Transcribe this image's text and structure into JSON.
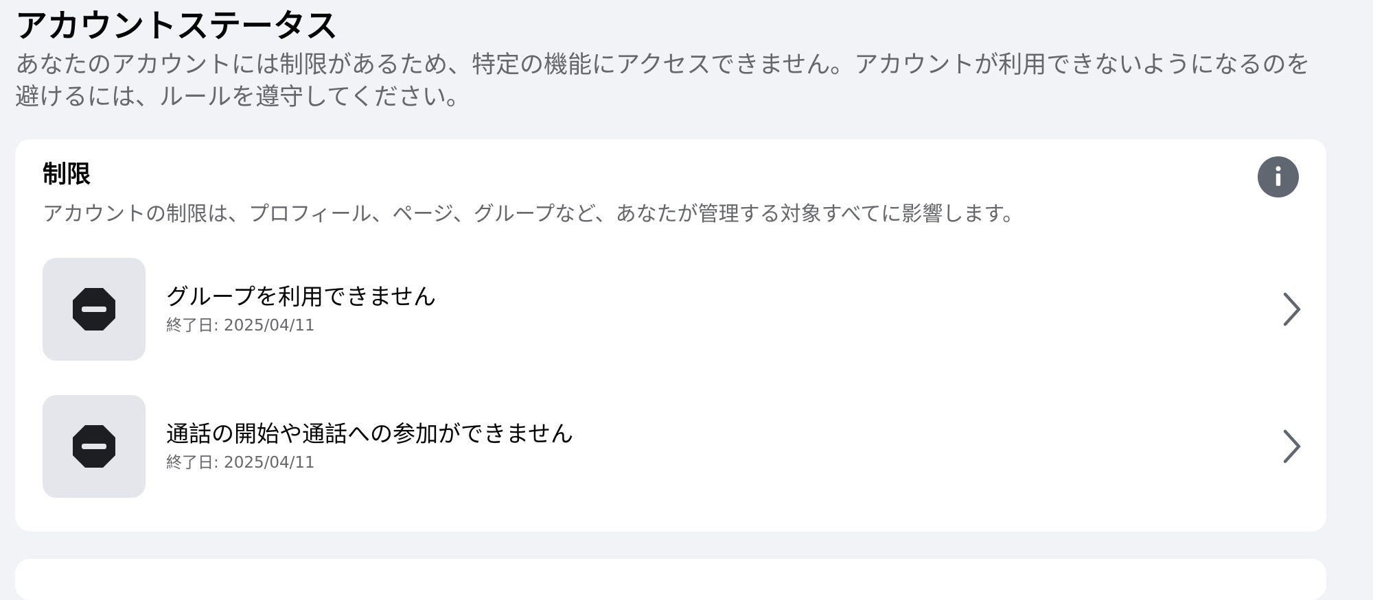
{
  "header": {
    "title": "アカウントステータス",
    "subtitle": "あなたのアカウントには制限があるため、特定の機能にアクセスできません。アカウントが利用できないようになるのを避けるには、ルールを遵守してください。"
  },
  "restrictions_card": {
    "title": "制限",
    "description": "アカウントの制限は、プロフィール、ページ、グループなど、あなたが管理する対象すべてに影響します。",
    "info_icon": "info-icon",
    "items": [
      {
        "icon": "restricted-icon",
        "title": "グループを利用できません",
        "end_date": "終了日: 2025/04/11"
      },
      {
        "icon": "restricted-icon",
        "title": "通話の開始や通話への参加ができません",
        "end_date": "終了日: 2025/04/11"
      }
    ]
  },
  "colors": {
    "background": "#f2f3f7",
    "card": "#ffffff",
    "icon_box": "#e4e6eb",
    "restricted_icon": "#1c1e21",
    "info_button": "#606770",
    "secondary_text": "#65676b",
    "chevron": "#606770"
  }
}
